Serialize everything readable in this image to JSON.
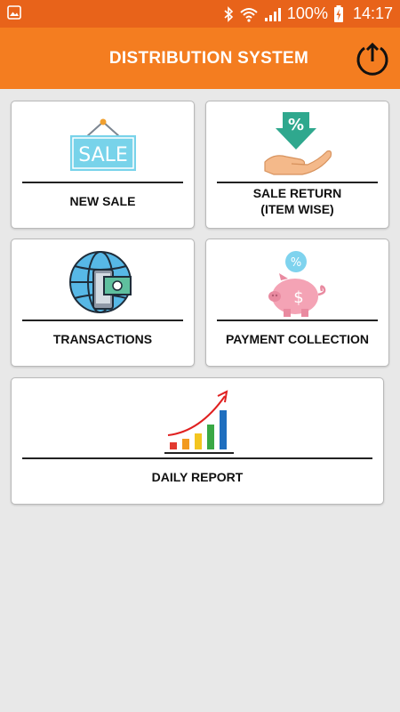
{
  "status_bar": {
    "battery": "100%",
    "time": "14:17",
    "icons": [
      "image-icon",
      "bluetooth-icon",
      "wifi-icon",
      "signal-icon",
      "battery-charging-icon"
    ]
  },
  "app_bar": {
    "title": "DISTRIBUTION SYSTEM",
    "action_icon": "upload-icon"
  },
  "menu": {
    "new_sale": {
      "label": "NEW SALE",
      "sign_text": "SALE",
      "icon": "sale-sign-icon"
    },
    "sale_return": {
      "label_line1": "SALE RETURN",
      "label_line2": "(ITEM WISE)",
      "badge_text": "%",
      "icon": "hand-discount-icon"
    },
    "transactions": {
      "label": "TRANSACTIONS",
      "icon": "globe-phone-money-icon"
    },
    "payment_collection": {
      "label": "PAYMENT COLLECTION",
      "icon": "piggy-bank-icon"
    },
    "daily_report": {
      "label": "DAILY REPORT",
      "icon": "growth-chart-icon"
    }
  },
  "colors": {
    "status_bar": "#e8631a",
    "app_bar": "#f47d20",
    "background": "#e8e8e8"
  }
}
